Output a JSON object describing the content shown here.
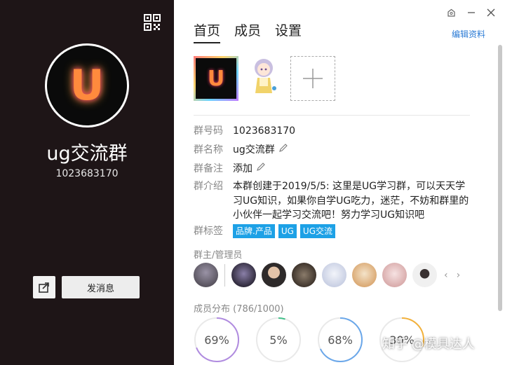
{
  "group": {
    "title": "ug交流群",
    "id": "1023683170",
    "avatar_glyph": "U"
  },
  "left_actions": {
    "share_icon": "share-icon",
    "send_label": "发消息"
  },
  "window": {
    "controls": [
      "skin-icon",
      "minimize-icon",
      "close-icon"
    ]
  },
  "tabs": [
    {
      "label": "首页",
      "active": true
    },
    {
      "label": "成员",
      "active": false
    },
    {
      "label": "设置",
      "active": false
    }
  ],
  "edit_label": "编辑资料",
  "info": {
    "id_label": "群号码",
    "id_value": "1023683170",
    "name_label": "群名称",
    "name_value": "ug交流群",
    "remark_label": "群备注",
    "remark_value": "添加",
    "intro_label": "群介绍",
    "intro_value": "本群创建于2019/5/5: 这里是UG学习群，可以天天学习UG知识，如果你自学UG吃力，迷茫，不妨和群里的小伙伴一起学习交流吧！努力学习UG知识吧",
    "tags_label": "群标签",
    "tags": [
      "品牌.产品",
      "UG",
      "UG交流"
    ]
  },
  "admins": {
    "title": "群主/管理员",
    "colors": [
      "#5a5560",
      "#3a3545",
      "#2e2a2a",
      "#4a4038",
      "#cfd6e8",
      "#e2b98a",
      "#e8c9c8",
      "#d8d8d8"
    ]
  },
  "distribution": {
    "title": "成员分布 (786/1000)",
    "rings": [
      {
        "label": "69%",
        "color": "#b08be0",
        "fraction": 0.69
      },
      {
        "label": "5%",
        "color": "#43c08a",
        "fraction": 0.05
      },
      {
        "label": "68%",
        "color": "#6aa7ea",
        "fraction": 0.68
      },
      {
        "label": "30%",
        "color": "#f3b13a",
        "fraction": 0.3
      }
    ]
  },
  "watermark": "知乎 @模具达人"
}
